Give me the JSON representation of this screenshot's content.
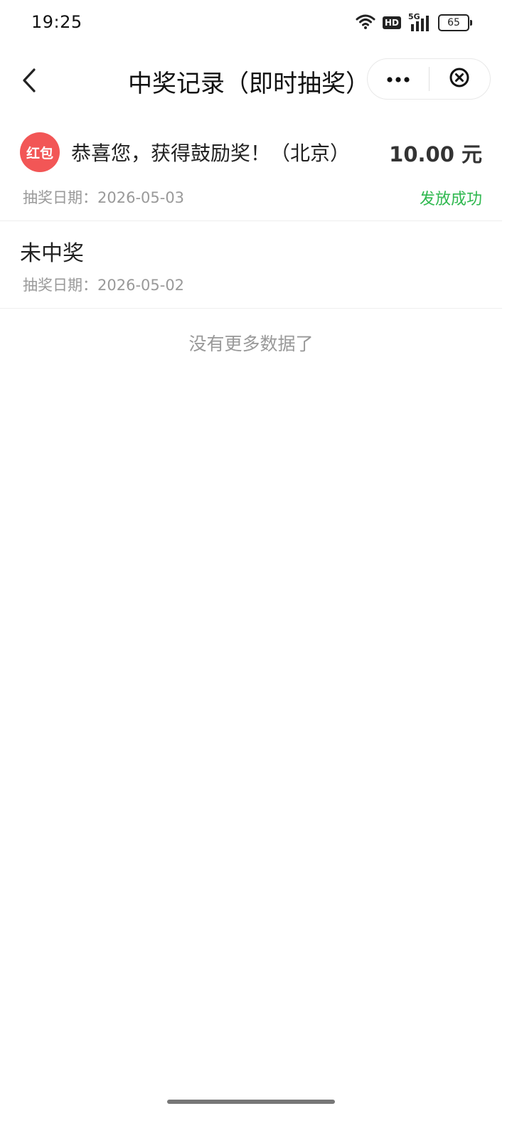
{
  "status_bar": {
    "time": "19:25",
    "hd": "HD",
    "network": "5G",
    "battery": "65",
    "icons": [
      "wifi-icon",
      "hd-icon",
      "signal-5g-icon",
      "battery-icon"
    ]
  },
  "nav": {
    "title": "中奖记录（即时抽奖）",
    "back_icon": "chevron-left-icon",
    "more_icon": "more-dots-icon",
    "close_icon": "close-circle-icon"
  },
  "records": [
    {
      "badge": "红包",
      "title": "恭喜您，获得鼓励奖！（北京）",
      "amount": "10.00 元",
      "date_label": "抽奖日期：2026-05-03",
      "status": "发放成功"
    },
    {
      "title": "未中奖",
      "date_label": "抽奖日期：2026-05-02"
    }
  ],
  "footer": {
    "no_more": "没有更多数据了"
  },
  "colors": {
    "badge_red": "#f25656",
    "success_green": "#2fb84f",
    "muted_gray": "#999999"
  }
}
